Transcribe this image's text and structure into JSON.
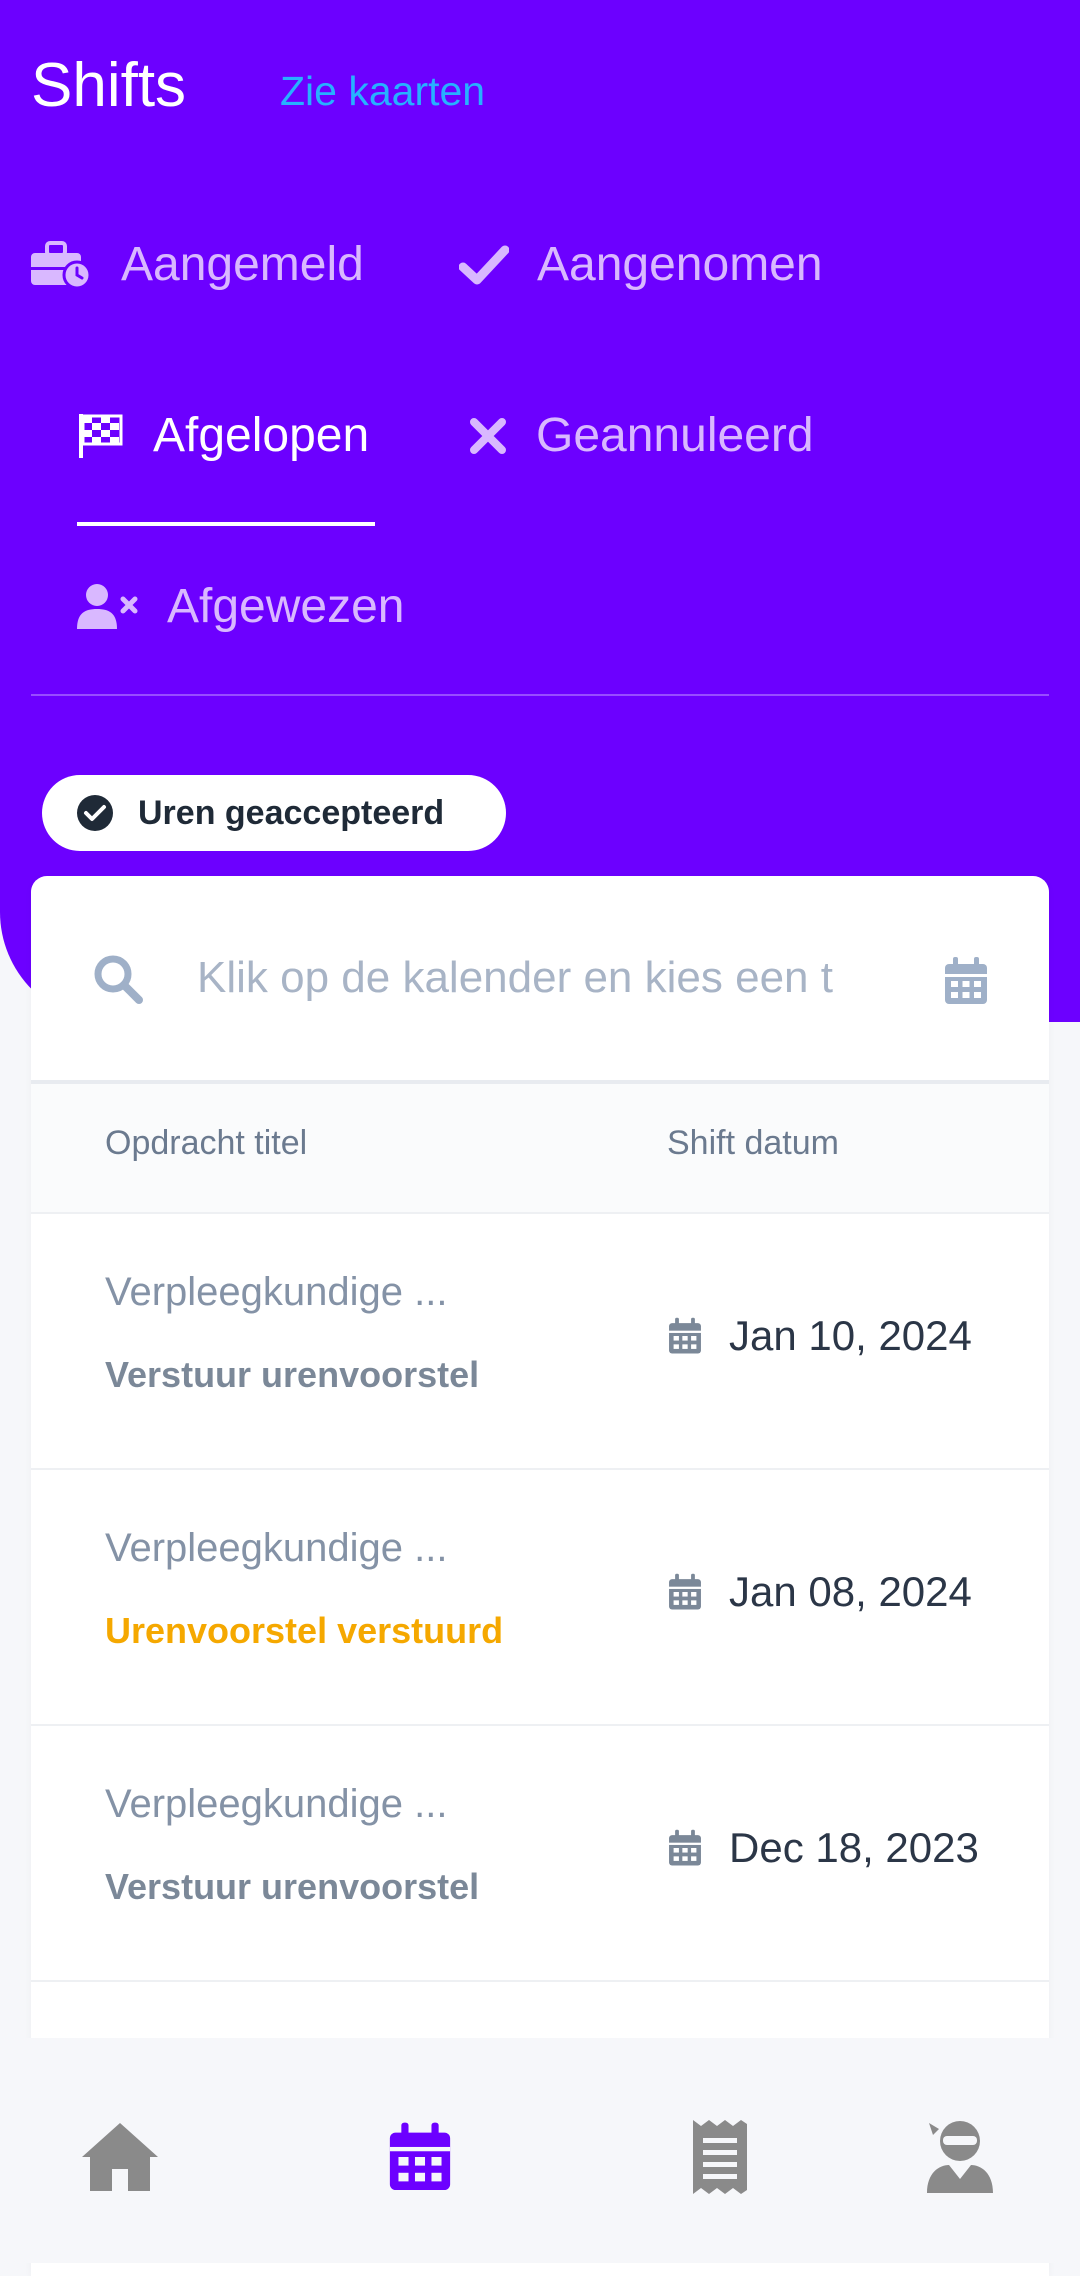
{
  "header": {
    "title": "Shifts",
    "map_link": "Zie kaarten"
  },
  "tabs": [
    {
      "label": "Aangemeld",
      "icon": "briefcase-clock-icon",
      "active": false
    },
    {
      "label": "Aangenomen",
      "icon": "check-icon",
      "active": false
    },
    {
      "label": "Afgelopen",
      "icon": "checkered-flag-icon",
      "active": true
    },
    {
      "label": "Geannuleerd",
      "icon": "x-icon",
      "active": false
    },
    {
      "label": "Afgewezen",
      "icon": "user-x-icon",
      "active": false
    }
  ],
  "filter_chip": {
    "label": "Uren geaccepteerd",
    "icon": "check-circle-icon"
  },
  "search": {
    "placeholder": "Klik op de kalender en kies een t",
    "value": ""
  },
  "table": {
    "columns": [
      "Opdracht titel",
      "Shift datum"
    ],
    "rows": [
      {
        "title": "Verpleegkundige ...",
        "status": "Verstuur urenvoorstel",
        "status_kind": "action",
        "date": "Jan 10, 2024"
      },
      {
        "title": "Verpleegkundige ...",
        "status": "Urenvoorstel verstuurd",
        "status_kind": "pending",
        "date": "Jan 08, 2024"
      },
      {
        "title": "Verpleegkundige ...",
        "status": "Verstuur urenvoorstel",
        "status_kind": "action",
        "date": "Dec 18, 2023"
      }
    ]
  },
  "bottom_nav": [
    {
      "name": "home",
      "icon": "home-icon",
      "active": false
    },
    {
      "name": "shifts",
      "icon": "calendar-icon",
      "active": true
    },
    {
      "name": "invoices",
      "icon": "receipt-icon",
      "active": false
    },
    {
      "name": "profile",
      "icon": "user-ninja-icon",
      "active": false
    }
  ],
  "colors": {
    "primary": "#6c00ff",
    "link": "#27b1ff",
    "tab_inactive": "#d9b8ff",
    "pending": "#f5a800",
    "nav_inactive": "#8a8a8a"
  }
}
